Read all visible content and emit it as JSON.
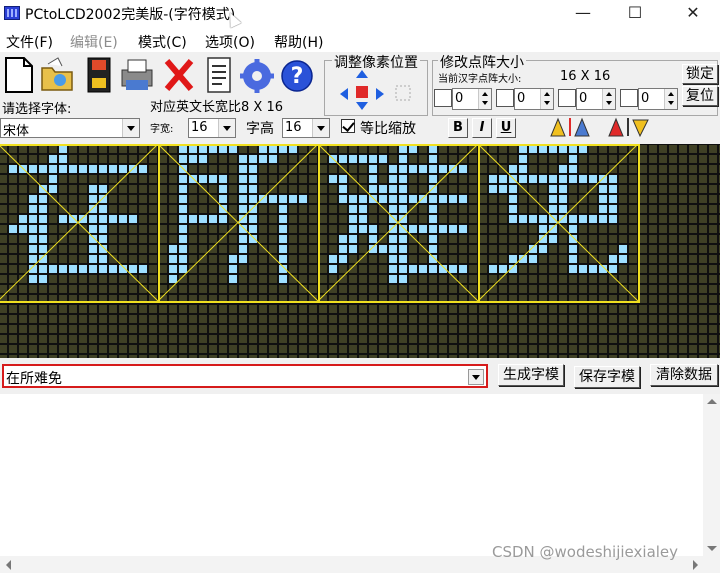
{
  "window": {
    "title": "PCtoLCD2002完美版-(字符模式)",
    "minimize": "—",
    "maximize": "☐",
    "close": "✕"
  },
  "menu": {
    "file": "文件(F)",
    "edit": "编辑(E)",
    "mode": "模式(C)",
    "options": "选项(O)",
    "help": "帮助(H)"
  },
  "toolbar": {
    "icons": [
      "new-file-icon",
      "open-folder-icon",
      "save-disk-icon",
      "print-icon",
      "delete-x-icon",
      "notes-icon",
      "gear-icon",
      "help-icon"
    ]
  },
  "font_panel": {
    "select_font_label": "请选择字体:",
    "font_value": "宋体",
    "english_ratio_label": "对应英文长宽比8 X 16",
    "width_label": "字宽:",
    "width_value": "16",
    "height_label": "字高",
    "height_value": "16",
    "proportional_label": "等比缩放",
    "proportional_checked": true,
    "bold": "B",
    "italic": "I",
    "underline": "U"
  },
  "pixel_adjust": {
    "title": "调整像素位置"
  },
  "matrix_size": {
    "title": "修改点阵大小",
    "current_label": "当前汉字点阵大小:",
    "current_value": "16  X  16",
    "lock_button": "锁定",
    "reset_button": "复位",
    "offsets": [
      "0",
      "0",
      "0",
      "0"
    ]
  },
  "preview": {
    "characters": [
      "在",
      "所",
      "难",
      "免"
    ],
    "background_color": "#101010",
    "off_pixel_color": "#3f4025",
    "on_pixel_color": "#9fe0ff",
    "frame_color": "#f0e020"
  },
  "bottom": {
    "input_value": "在所难免",
    "generate_button": "生成字模",
    "save_button": "保存字模",
    "clear_button": "清除数据"
  },
  "watermark": "CSDN @wodeshijiexialey"
}
